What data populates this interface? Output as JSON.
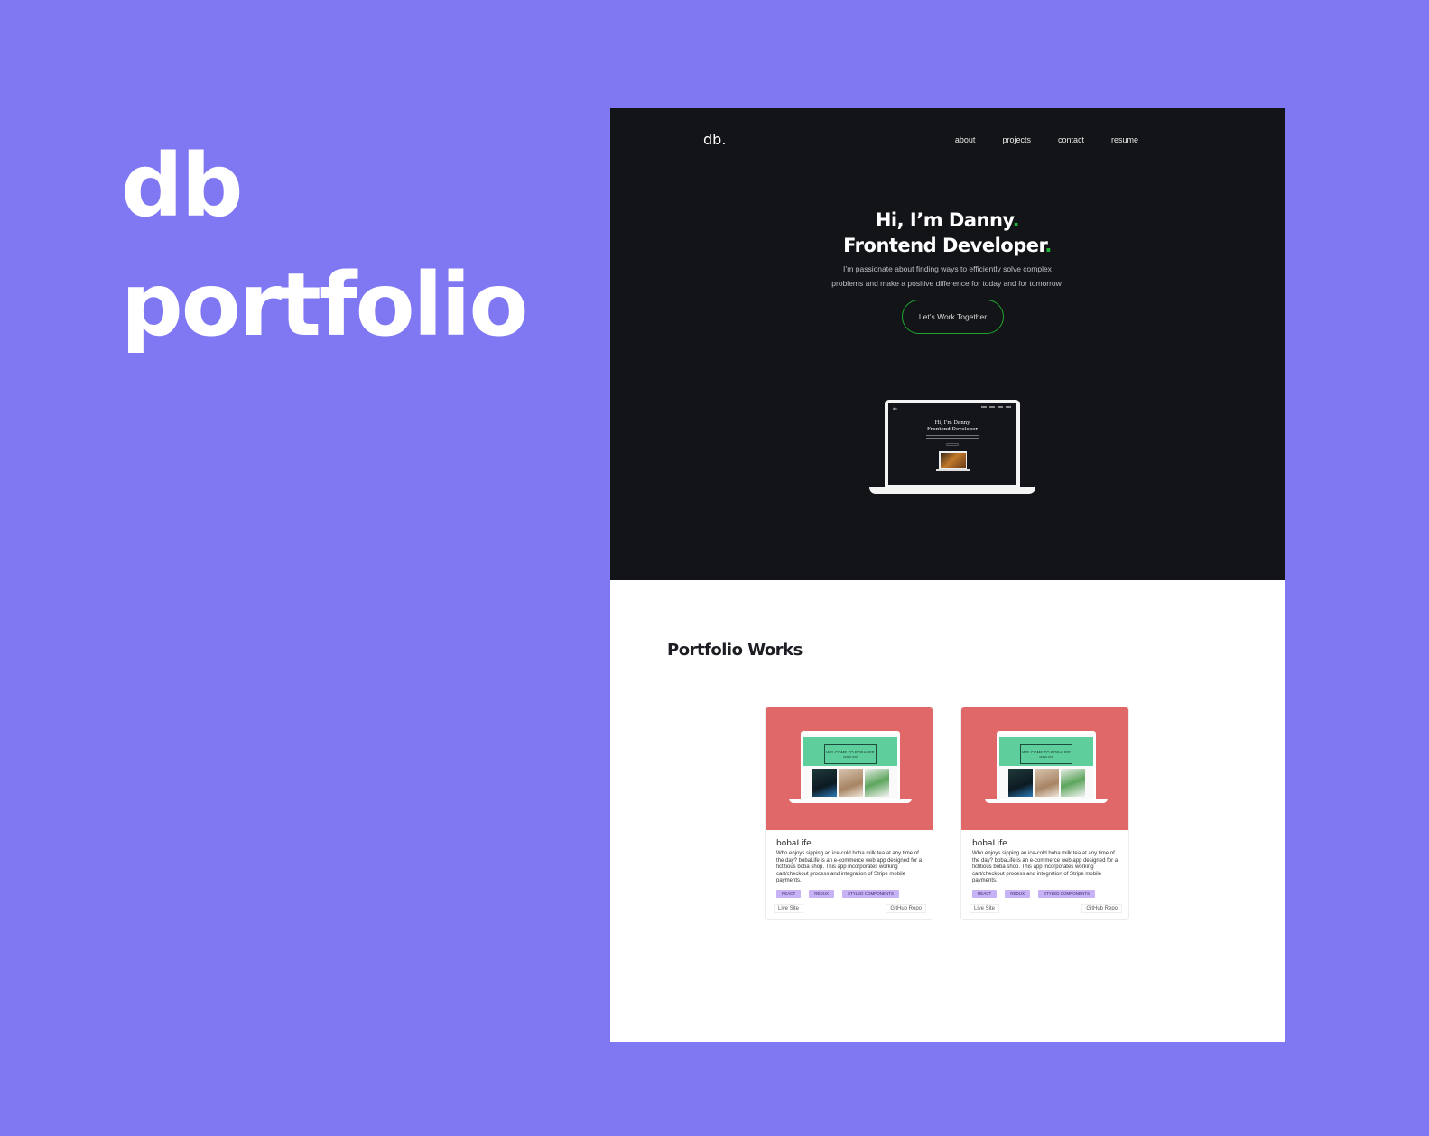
{
  "brand": {
    "line1": "db",
    "line2": "portfolio"
  },
  "site": {
    "logo": "db.",
    "nav": [
      "about",
      "projects",
      "contact",
      "resume"
    ],
    "hero": {
      "line1": "Hi, I’m Danny",
      "line2": "Frontend Developer",
      "dot": ".",
      "sub1": "I’m passionate about finding ways to efficiently solve complex",
      "sub2": "problems and make a positive difference for today and for tomorrow.",
      "cta": "Let’s Work Together",
      "accent": "#1fb53a"
    },
    "laptop_screen": {
      "logo": "db.",
      "line1": "Hi, I’m Danny",
      "line2": "Frontend Developer"
    },
    "portfolio": {
      "title": "Portfolio Works",
      "cards": [
        {
          "banner_title": "WELCOME TO BOBALIFE",
          "banner_sub": "ORDER NOW",
          "title": "bobaLife",
          "description": "Who enjoys sipping an ice-cold boba milk tea at any time of the day? bobaLife is an e-commerce web app designed for a fictitious boba shop. This app incorporates working cart/checkout process and integration of Stripe mobile payments.",
          "tags": [
            "REACT",
            "REDUX",
            "STYLED COMPONENTS"
          ],
          "live": "Live Site",
          "repo": "GitHub Repo"
        },
        {
          "banner_title": "WELCOME TO BOBALIFE",
          "banner_sub": "ORDER NOW",
          "title": "bobaLife",
          "description": "Who enjoys sipping an ice-cold boba milk tea at any time of the day? bobaLife is an e-commerce web app designed for a fictitious boba shop. This app incorporates working cart/checkout process and integration of Stripe mobile payments.",
          "tags": [
            "REACT",
            "REDUX",
            "STYLED COMPONENTS"
          ],
          "live": "Live Site",
          "repo": "GitHub Repo"
        }
      ]
    }
  },
  "colors": {
    "background": "#8078f2",
    "hero": "#131418",
    "card_image": "#e06868",
    "tag": "#c6b2f5"
  }
}
